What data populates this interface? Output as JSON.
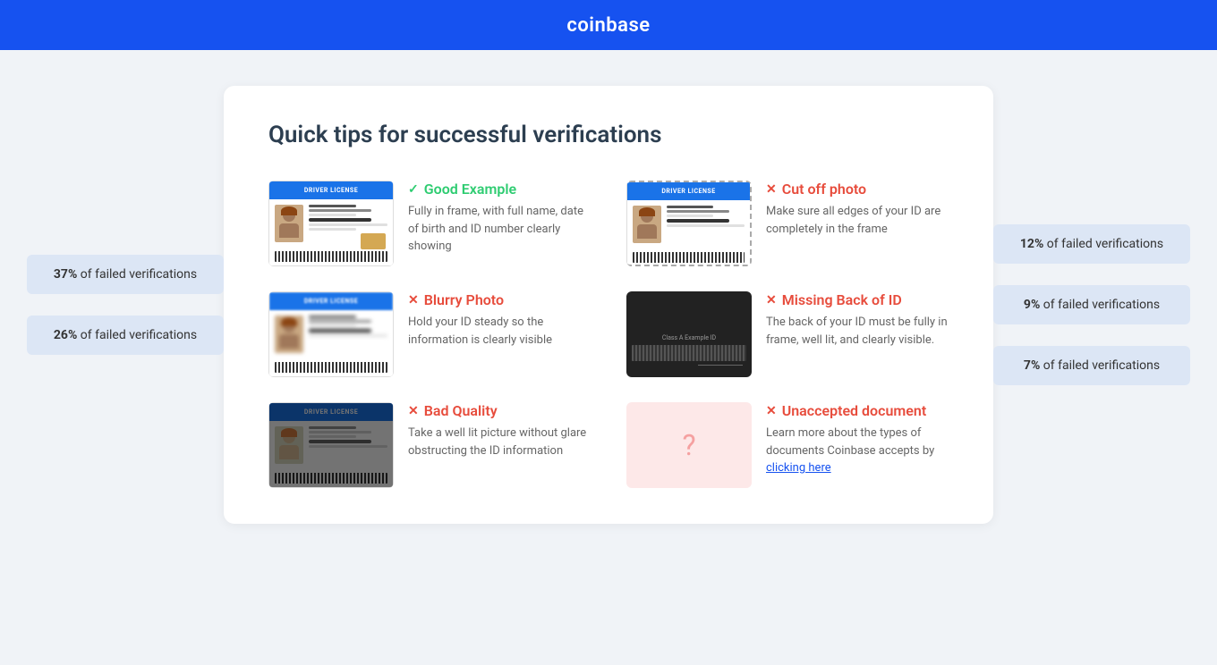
{
  "header": {
    "logo": "coinbase"
  },
  "card": {
    "title": "Quick tips for successful verifications"
  },
  "left_badges": [
    {
      "percent": "37%",
      "label": "of failed verifications"
    },
    {
      "percent": "26%",
      "label": "of failed verifications"
    }
  ],
  "right_badges": [
    {
      "percent": "12%",
      "label": "of failed verifications"
    },
    {
      "percent": "9%",
      "label": "of failed verifications"
    },
    {
      "percent": "7%",
      "label": "of failed verifications"
    }
  ],
  "tips": [
    {
      "id": "good-example",
      "icon_type": "check",
      "label": "Good Example",
      "description": "Fully in frame, with full name, date of birth and ID number clearly showing",
      "image_type": "id-normal"
    },
    {
      "id": "cut-off-photo",
      "icon_type": "cross",
      "label": "Cut off photo",
      "description": "Make sure all edges of your ID are completely in the frame",
      "image_type": "id-cutoff"
    },
    {
      "id": "blurry-photo",
      "icon_type": "cross",
      "label": "Blurry Photo",
      "description": "Hold your ID steady so the information is clearly visible",
      "image_type": "id-blurry"
    },
    {
      "id": "missing-back-of-id",
      "icon_type": "cross",
      "label": "Missing Back of ID",
      "description": "The back of your ID must be fully in frame, well lit, and clearly visible.",
      "image_type": "id-back"
    },
    {
      "id": "bad-quality",
      "icon_type": "cross",
      "label": "Bad Quality",
      "description": "Take a well lit picture without glare obstructing the ID information",
      "image_type": "id-bad-quality"
    },
    {
      "id": "unaccepted-document",
      "icon_type": "cross",
      "label": "Unaccepted document",
      "description": "Learn more about the types of documents Coinbase accepts by",
      "link_text": "clicking here",
      "link_href": "#",
      "image_type": "id-unknown"
    }
  ]
}
